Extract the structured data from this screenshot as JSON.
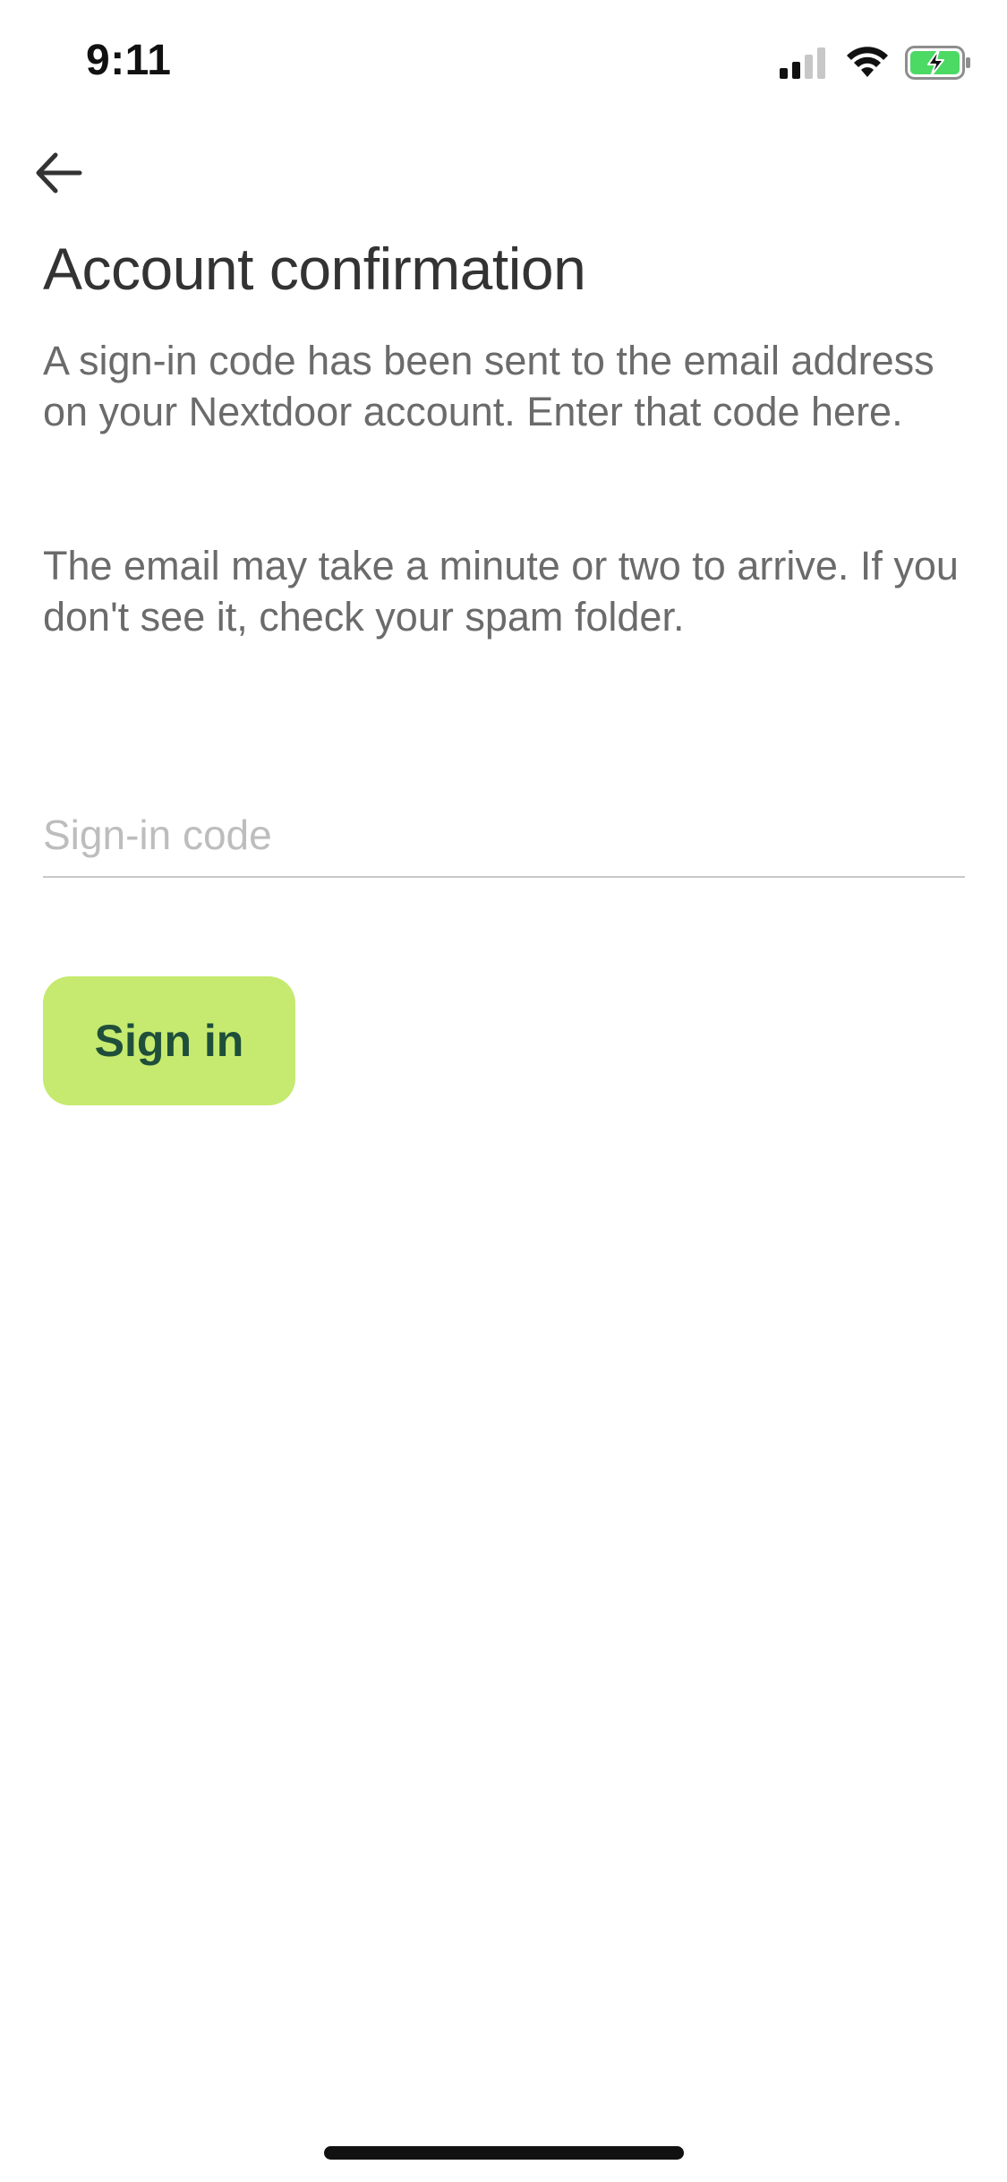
{
  "status_bar": {
    "time": "9:11",
    "icons": [
      "cellular-signal-icon",
      "wifi-icon",
      "battery-charging-icon"
    ],
    "battery_color": "#4cd964"
  },
  "nav": {
    "back_icon": "arrow-left-icon"
  },
  "content": {
    "title": "Account confirmation",
    "paragraph_1": "A sign-in code has been sent to the email address on your Nextdoor account. Enter that code here.",
    "paragraph_2": "The email may take a minute or two to arrive. If you don't see it, check your spam folder.",
    "code_input": {
      "value": "",
      "placeholder": "Sign-in code"
    },
    "signin_button": "Sign in"
  },
  "colors": {
    "button_background": "#c5ea6f",
    "button_text": "#1f4f3a",
    "title_text": "#333333",
    "body_text": "#6b6b6b",
    "placeholder_text": "#bdbdbd"
  }
}
